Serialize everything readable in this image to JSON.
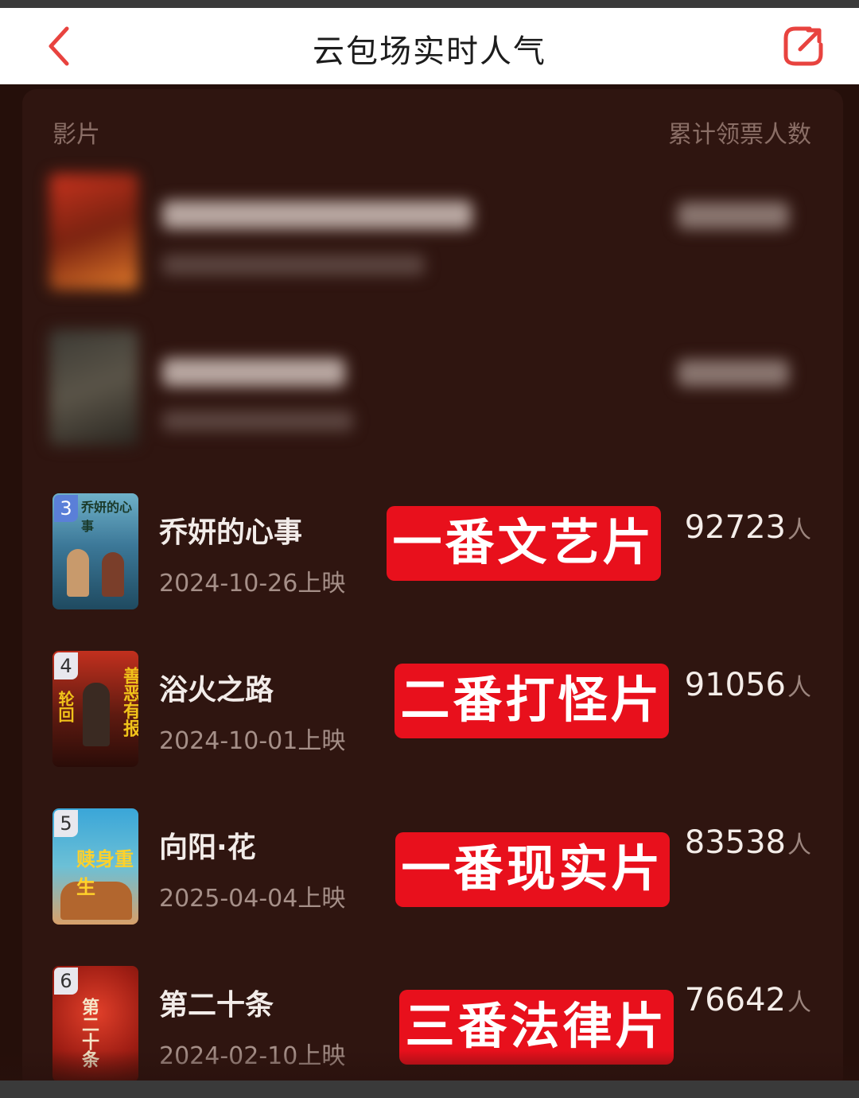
{
  "header": {
    "title": "云包场实时人气",
    "back_icon": "chevron-left-icon",
    "share_icon": "share-icon",
    "accent_color": "#e8433f"
  },
  "table": {
    "col_film": "影片",
    "col_count": "累计领票人数"
  },
  "rows": [
    {
      "rank": "3",
      "title": "乔妍的心事",
      "date": "2024-10-26上映",
      "count": "92723",
      "unit": "人",
      "tag": "一番文艺片"
    },
    {
      "rank": "4",
      "title": "浴火之路",
      "date": "2024-10-01上映",
      "count": "91056",
      "unit": "人",
      "tag": "二番打怪片"
    },
    {
      "rank": "5",
      "title": "向阳·花",
      "date": "2025-04-04上映",
      "count": "83538",
      "unit": "人",
      "tag": "一番现实片"
    },
    {
      "rank": "6",
      "title": "第二十条",
      "date": "2024-02-10上映",
      "count": "76642",
      "unit": "人",
      "tag": "三番法律片"
    }
  ],
  "posters": {
    "p3_text": "乔妍的心事",
    "p4_left": "善恶有报",
    "p4_right": "轮回",
    "p5_text": "赎身重生",
    "p6_text": "第二十条"
  },
  "colors": {
    "tag_red": "#e8101c",
    "background": "#2f1510"
  }
}
